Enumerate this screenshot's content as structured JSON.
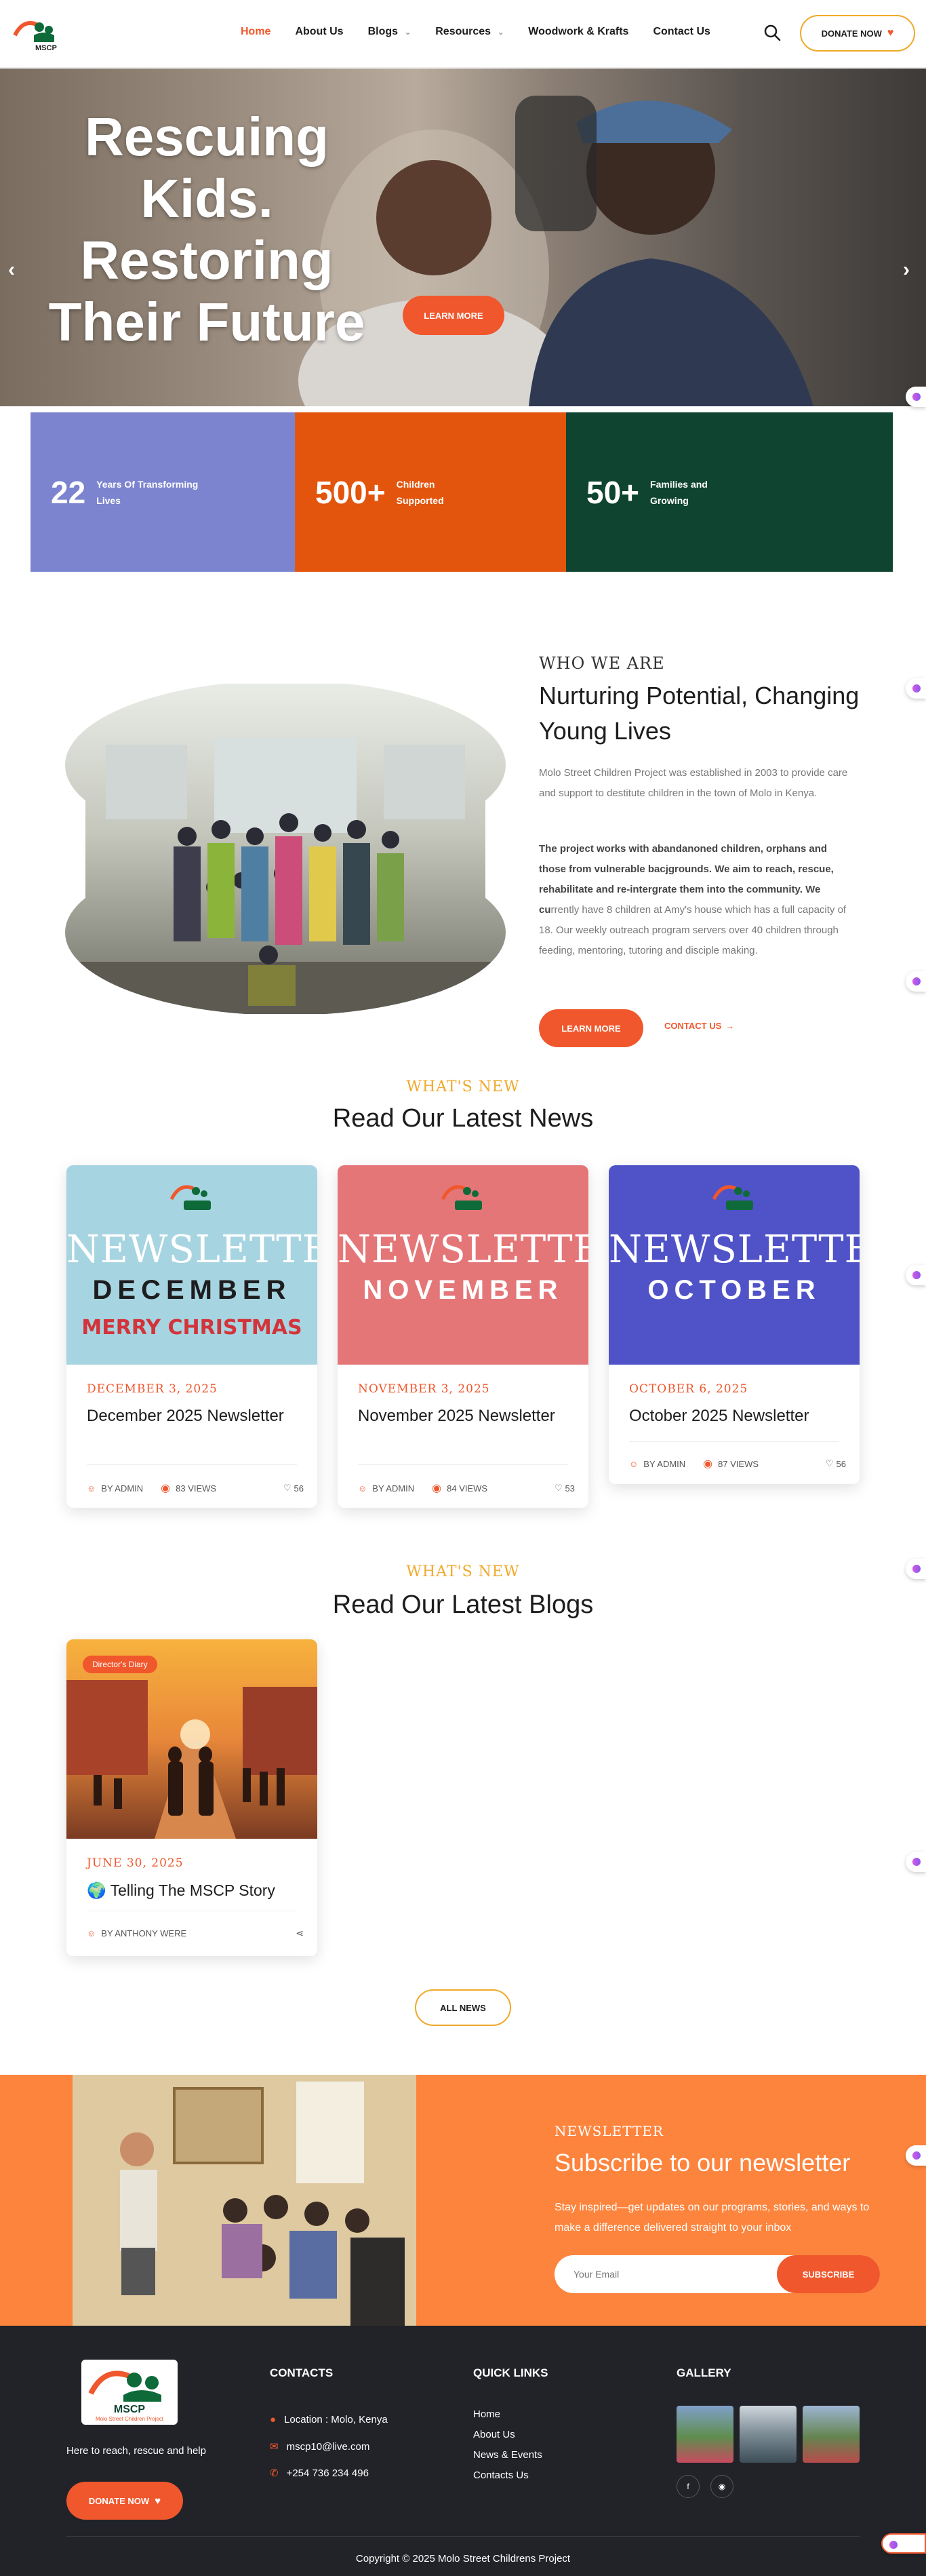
{
  "header": {
    "logo_text": "MSCP",
    "nav": [
      {
        "label": "Home",
        "active": true,
        "dropdown": false
      },
      {
        "label": "About Us",
        "active": false,
        "dropdown": false
      },
      {
        "label": "Blogs",
        "active": false,
        "dropdown": true
      },
      {
        "label": "Resources",
        "active": false,
        "dropdown": true
      },
      {
        "label": "Woodwork & Krafts",
        "active": false,
        "dropdown": false
      },
      {
        "label": "Contact Us",
        "active": false,
        "dropdown": false
      }
    ],
    "donate_label": "DONATE NOW",
    "donate_icon": "heart-icon",
    "search_icon": "search-icon"
  },
  "hero": {
    "title": "Rescuing Kids. Restoring Their Future",
    "button_label": "LEARN MORE"
  },
  "stats": [
    {
      "number": "22",
      "label": "Years Of Transforming Lives",
      "color": "#7c84cf"
    },
    {
      "number": "500+",
      "label": "Children Supported",
      "color": "#e3540c"
    },
    {
      "number": "50+",
      "label": "Families and Growing",
      "color": "#0f4430"
    }
  ],
  "about": {
    "label": "WHO WE ARE",
    "title": "Nurturing Potential, Changing Young Lives",
    "paragraph1": "Molo Street Children Project was established in 2003 to provide care and support to destitute children in the town of Molo in Kenya.",
    "paragraph2_bold": "The project works with abandanoned children, orphans and those from vulnerable bacjgrounds. We aim to reach, rescue, rehabilitate and re-intergrate them into the community. We cu",
    "paragraph2_rest": "rrently have 8 children at Amy's house which has a full capacity of 18. Our weekly outreach program servers over 40 children through feeding, mentoring, tutoring and disciple making.",
    "learn_more": "LEARN MORE",
    "contact_us": "CONTACT US"
  },
  "news": {
    "label": "WHAT'S NEW",
    "title": "Read Our Latest News",
    "items": [
      {
        "image_word": "NEWSLETTER",
        "image_month": "DECEMBER",
        "image_extra": "MERRY CHRISTMAS",
        "bg": "#a7d4e1",
        "month_color": "#1d1d1f",
        "date": "DECEMBER 3, 2025",
        "title": "December 2025 Newsletter",
        "author": "BY ADMIN",
        "views": "83 VIEWS",
        "likes": "56"
      },
      {
        "image_word": "NEWSLETTER",
        "image_month": "NOVEMBER",
        "image_extra": "",
        "bg": "#e47678",
        "month_color": "#ffffff",
        "date": "NOVEMBER 3, 2025",
        "title": "November 2025 Newsletter",
        "author": "BY ADMIN",
        "views": "84 VIEWS",
        "likes": "53"
      },
      {
        "image_word": "NEWSLETTER",
        "image_month": "OCTOBER",
        "image_extra": "",
        "bg": "#4f53c7",
        "month_color": "#ffffff",
        "date": "OCTOBER 6, 2025",
        "title": "October 2025 Newsletter",
        "author": "BY ADMIN",
        "views": "87 VIEWS",
        "likes": "56"
      }
    ]
  },
  "blogs": {
    "label": "WHAT'S NEW",
    "title": "Read Our Latest Blogs",
    "items": [
      {
        "badge": "Director's Diary",
        "date": "JUNE 30, 2025",
        "title": "🌍 Telling The MSCP Story",
        "author": "BY ANTHONY WERE"
      }
    ],
    "all_news": "ALL NEWS"
  },
  "newsletter": {
    "label": "NEWSLETTER",
    "title": "Subscribe to our newsletter",
    "text": "Stay inspired—get updates on our programs, stories, and ways to make a difference delivered straight to your inbox",
    "placeholder": "Your Email",
    "button": "SUBSCRIBE"
  },
  "footer": {
    "logo_text": "MSCP",
    "logo_sub": "Molo Street Children Project",
    "tagline": "Here to reach, rescue and help",
    "donate": "DONATE NOW",
    "contacts_title": "CONTACTS",
    "location": "Location : Molo, Kenya",
    "email": "mscp10@live.com",
    "phone": "+254 736  234  496",
    "links_title": "QUICK LINKS",
    "links": [
      "Home",
      "About Us",
      "News & Events",
      "Contacts Us"
    ],
    "gallery_title": "GALLERY",
    "social": [
      "facebook-icon",
      "instagram-icon"
    ],
    "copyright": "Copyright © 2025 Molo Street Childrens Project"
  }
}
